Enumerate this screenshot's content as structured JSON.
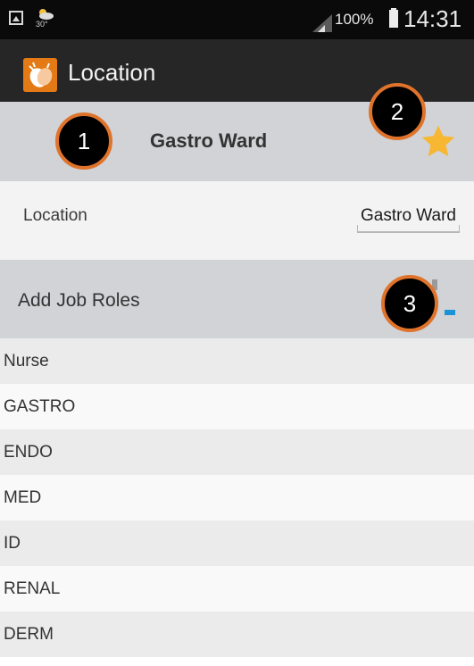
{
  "status_bar": {
    "weather_temp": "30°",
    "battery": "100%",
    "time": "14:31"
  },
  "action_bar": {
    "title": "Location",
    "logo_icon": "clapping-hands-icon"
  },
  "location_header": {
    "title": "Gastro Ward",
    "star_color": "#f7b733"
  },
  "location_field": {
    "label": "Location",
    "value": "Gastro Ward"
  },
  "job_roles": {
    "header": "Add Job Roles",
    "items": [
      "Nurse",
      "GASTRO",
      "ENDO",
      "MED",
      "ID",
      "RENAL",
      "DERM"
    ]
  },
  "annotations": {
    "badge_1": "1",
    "badge_2": "2",
    "badge_3": "3",
    "badge_color": "#e0732b"
  },
  "colors": {
    "status_bar": "#0a0a0a",
    "action_bar": "#262626",
    "section_header": "#d1d3d6",
    "accent_blue": "#1a94d6",
    "logo_orange": "#e37a16"
  }
}
